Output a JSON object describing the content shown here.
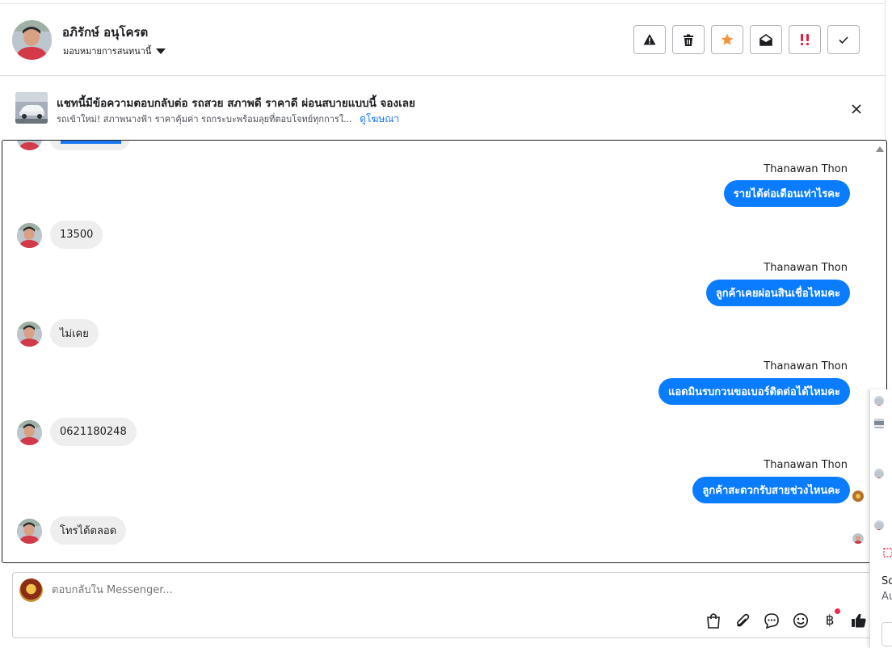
{
  "header": {
    "contact_name": "อภิรักษ์ อนุโครต",
    "assign_label": "มอบหมายการสนทนานี้",
    "actions": [
      "warning-icon",
      "trash-icon",
      "star-icon",
      "mark-unread-icon",
      "important-icon",
      "check-icon"
    ]
  },
  "banner": {
    "title": "แชทนี้มีข้อความตอบกลับต่อ รถสวย สภาพดี ราคาดี ผ่อนสบายแบบนี้ จองเลย",
    "description": "รถเข้าใหม่! สภาพนางฟ้า ราคาคุ้มค่า รถกระบะพร้อมลุยที่ตอบโจทย์ทุกการใ...",
    "link": "ดูโฆษณา"
  },
  "messages": [
    {
      "direction": "out",
      "sender": "Thanawan Thon",
      "text": "รายได้ต่อเดือนเท่าไรคะ"
    },
    {
      "direction": "in",
      "text": "13500"
    },
    {
      "direction": "out",
      "sender": "Thanawan Thon",
      "text": "ลูกค้าเคยผ่อนสินเชื่อไหมคะ"
    },
    {
      "direction": "in",
      "text": "ไม่เคย"
    },
    {
      "direction": "out",
      "sender": "Thanawan Thon",
      "text": "แอดมินรบกวนขอเบอร์ติดต่อได้ไหมคะ"
    },
    {
      "direction": "in",
      "text": "0621180248"
    },
    {
      "direction": "out",
      "sender": "Thanawan Thon",
      "text": "ลูกค้าสะดวกรับสายช่วงไหนคะ"
    },
    {
      "direction": "in",
      "text": "โทรได้ตลอด"
    }
  ],
  "composer": {
    "placeholder": "ตอบกลับใน Messenger...",
    "tools": [
      "shopping-bag-icon",
      "paperclip-icon",
      "chat-bubble-icon",
      "emoji-icon",
      "baht-icon",
      "thumbs-up-icon"
    ],
    "baht_symbol": "฿"
  },
  "side_panel": {
    "line1": "So",
    "line2": "Au"
  },
  "colors": {
    "outgoing_bubble": "#0a7cff",
    "incoming_bubble": "#eeeeee",
    "link": "#1877f2",
    "important": "#e41e3f",
    "star": "#f7923b"
  }
}
